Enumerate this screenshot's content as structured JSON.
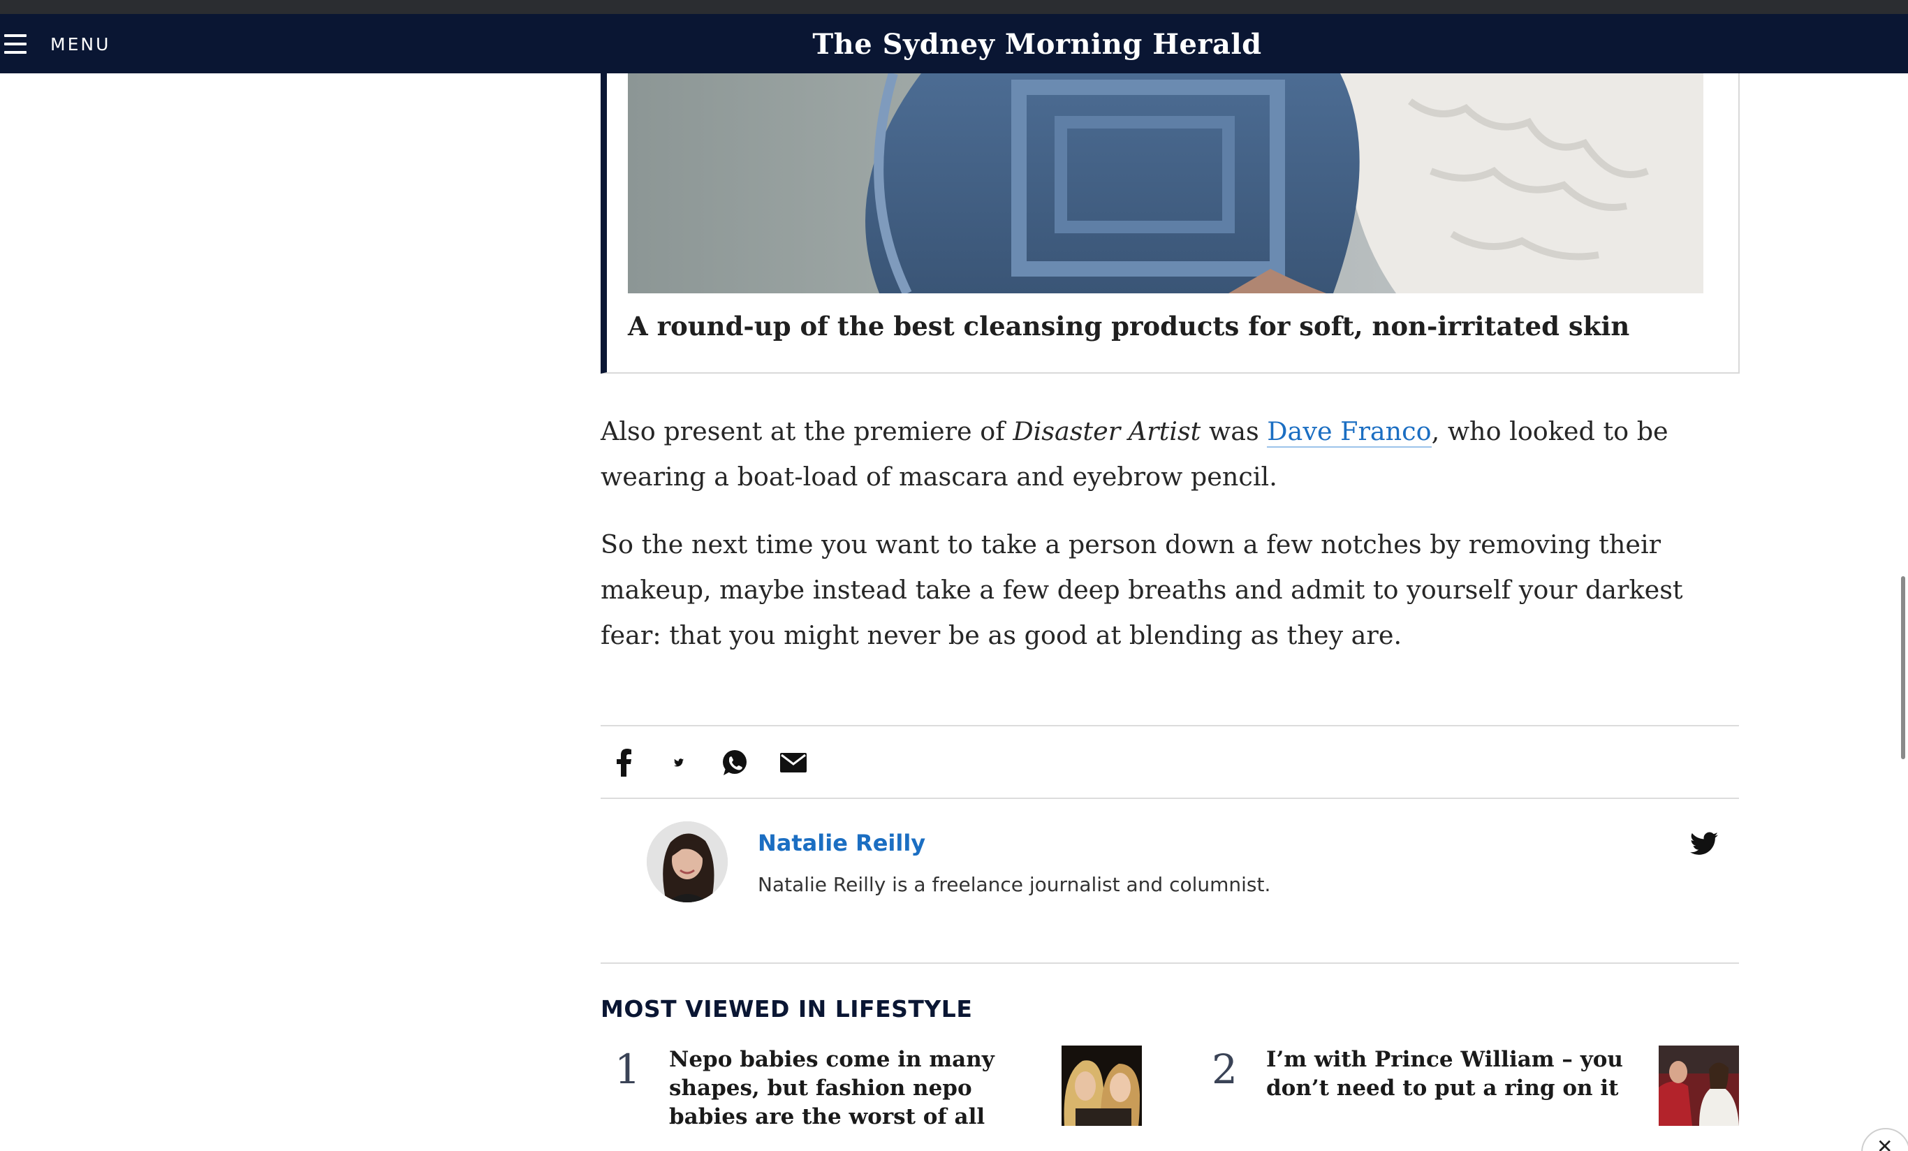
{
  "header": {
    "menu_label": "MENU",
    "masthead": "The Sydney Morning Herald"
  },
  "promo": {
    "title": "A round-up of the best cleansing products for soft, non-irritated skin"
  },
  "article": {
    "p1_before": "Also present at the premiere of ",
    "p1_em": "Disaster Artist",
    "p1_mid": " was ",
    "p1_link": "Dave Franco",
    "p1_after": ", who looked to be wearing a boat-load of mascara and eyebrow pencil.",
    "p2": "So the next time you want to take a person down a few notches by removing their makeup, maybe instead take a few deep breaths and admit to yourself your darkest fear: that you might never be as good at blending as they are."
  },
  "share": {
    "icons": [
      "facebook-icon",
      "twitter-icon",
      "whatsapp-icon",
      "email-icon"
    ]
  },
  "author": {
    "name": "Natalie Reilly",
    "bio": "Natalie Reilly is a freelance journalist and columnist."
  },
  "most_viewed": {
    "title": "MOST VIEWED IN LIFESTYLE",
    "items": [
      {
        "rank": "1",
        "headline": "Nepo babies come in many shapes, but fashion nepo babies are the worst of all"
      },
      {
        "rank": "2",
        "headline": "I’m with Prince William – you don’t need to put a ring on it"
      }
    ]
  },
  "colors": {
    "brand_navy": "#0a1633",
    "link_blue": "#1b6ec2"
  }
}
